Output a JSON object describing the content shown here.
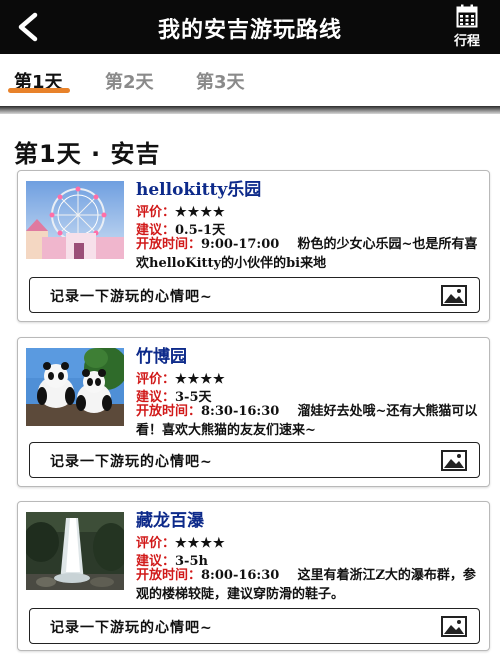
{
  "header": {
    "title": "我的安吉游玩路线",
    "back_icon": "back-arrow-icon",
    "itinerary_icon": "calendar-icon",
    "itinerary_label": "行程"
  },
  "tabs": [
    {
      "label": "第1天",
      "active": true
    },
    {
      "label": "第2天",
      "active": false
    },
    {
      "label": "第3天",
      "active": false
    }
  ],
  "accent_color": "#e8822a",
  "section_title": "第1天 · 安吉",
  "cards": [
    {
      "name": "hellokitty乐园",
      "rating_label": "评价：",
      "rating_stars": "★★★★",
      "suggest_label": "建议：",
      "suggest_value": "0.5-1天",
      "hours_label": "开放时间：",
      "hours_value": "9:00-17:00",
      "description": "粉色的少女心乐园~也是所有喜欢helloKitty的小伙伴的bi来地",
      "mood_placeholder": "记录一下游玩的心情吧~",
      "photo_icon": "image-icon"
    },
    {
      "name": "竹博园",
      "rating_label": "评价：",
      "rating_stars": "★★★★",
      "suggest_label": "建议：",
      "suggest_value": "3-5天",
      "hours_label": "开放时间：",
      "hours_value": "8:30-16:30",
      "description": "溜娃好去处哦~还有大熊猫可以看！喜欢大熊猫的友友们速来~",
      "mood_placeholder": "记录一下游玩的心情吧~",
      "photo_icon": "image-icon"
    },
    {
      "name": "藏龙百瀑",
      "rating_label": "评价：",
      "rating_stars": "★★★★",
      "suggest_label": "建议：",
      "suggest_value": "3-5h",
      "hours_label": "开放时间：",
      "hours_value": "8:00-16:30",
      "description": "这里有着浙江Z大的瀑布群，参观的楼梯较陡，建议穿防滑的鞋子。",
      "mood_placeholder": "记录一下游玩的心情吧~",
      "photo_icon": "image-icon"
    }
  ]
}
